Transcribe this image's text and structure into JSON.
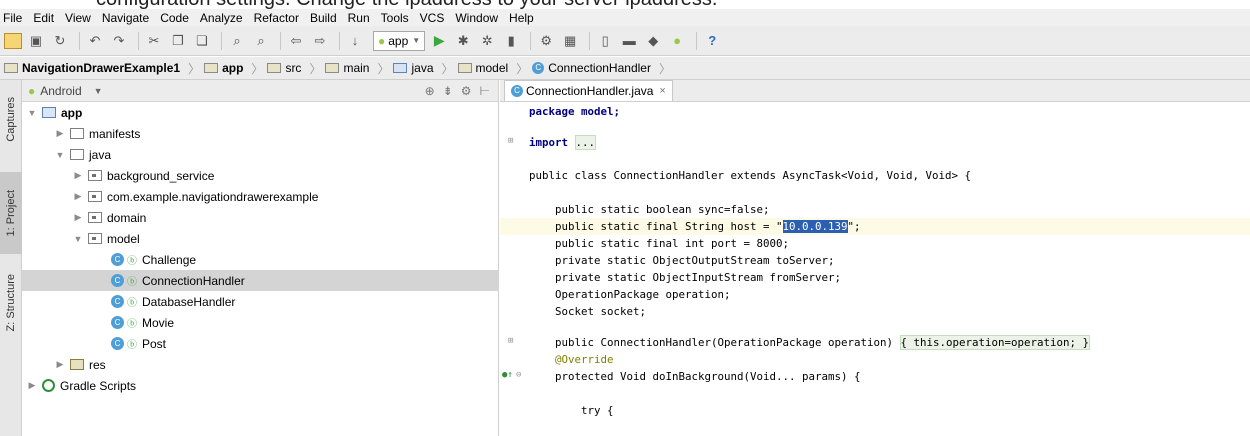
{
  "caption": "configuration settings. Change the ipaddress to your server ipaddress.",
  "menu": [
    "File",
    "Edit",
    "View",
    "Navigate",
    "Code",
    "Analyze",
    "Refactor",
    "Build",
    "Run",
    "Tools",
    "VCS",
    "Window",
    "Help"
  ],
  "toolbar": {
    "run_config": "app"
  },
  "breadcrumb": [
    "NavigationDrawerExample1",
    "app",
    "src",
    "main",
    "java",
    "model",
    "ConnectionHandler"
  ],
  "side_tabs": {
    "captures": "Captures",
    "project": "1: Project",
    "structure": "Z: Structure"
  },
  "project": {
    "view": "Android",
    "tree": [
      {
        "label": "app",
        "depth": 0,
        "expanded": true,
        "icon": "module-folder-icon"
      },
      {
        "label": "manifests",
        "depth": 1,
        "expanded": false,
        "icon": "folder-icon"
      },
      {
        "label": "java",
        "depth": 1,
        "expanded": true,
        "icon": "folder-icon"
      },
      {
        "label": "background_service",
        "depth": 2,
        "expanded": false,
        "icon": "package-icon"
      },
      {
        "label": "com.example.navigationdrawerexample",
        "depth": 2,
        "expanded": false,
        "icon": "package-icon"
      },
      {
        "label": "domain",
        "depth": 2,
        "expanded": false,
        "icon": "package-icon"
      },
      {
        "label": "model",
        "depth": 2,
        "expanded": true,
        "icon": "package-icon"
      },
      {
        "label": "Challenge",
        "depth": 3,
        "icon": "class-icon"
      },
      {
        "label": "ConnectionHandler",
        "depth": 3,
        "icon": "class-icon",
        "selected": true
      },
      {
        "label": "DatabaseHandler",
        "depth": 3,
        "icon": "class-icon"
      },
      {
        "label": "Movie",
        "depth": 3,
        "icon": "class-icon"
      },
      {
        "label": "Post",
        "depth": 3,
        "icon": "class-icon"
      },
      {
        "label": "res",
        "depth": 1,
        "expanded": false,
        "icon": "res-folder-icon"
      },
      {
        "label": "Gradle Scripts",
        "depth": 0,
        "expanded": false,
        "icon": "gradle-icon"
      }
    ]
  },
  "editor": {
    "tab": "ConnectionHandler.java",
    "lines": {
      "l1": "package model;",
      "l2_kw": "import",
      "l2_fold": "...",
      "l3": "public class ConnectionHandler extends AsyncTask<Void, Void, Void> {",
      "l4": "public static boolean sync=false;",
      "l5_pre": "public static final String host = \"",
      "l5_sel": "10.0.0.139",
      "l5_post": "\";",
      "l6": "public static final int port = 8000;",
      "l7": "private static ObjectOutputStream toServer;",
      "l8": "private static ObjectInputStream fromServer;",
      "l9": "OperationPackage operation;",
      "l10": "Socket socket;",
      "l11_head": "public ConnectionHandler(OperationPackage operation) ",
      "l11_body": "{ this.operation=operation; }",
      "l12": "@Override",
      "l13": "protected Void doInBackground(Void... params) {",
      "l14": "try {"
    }
  }
}
